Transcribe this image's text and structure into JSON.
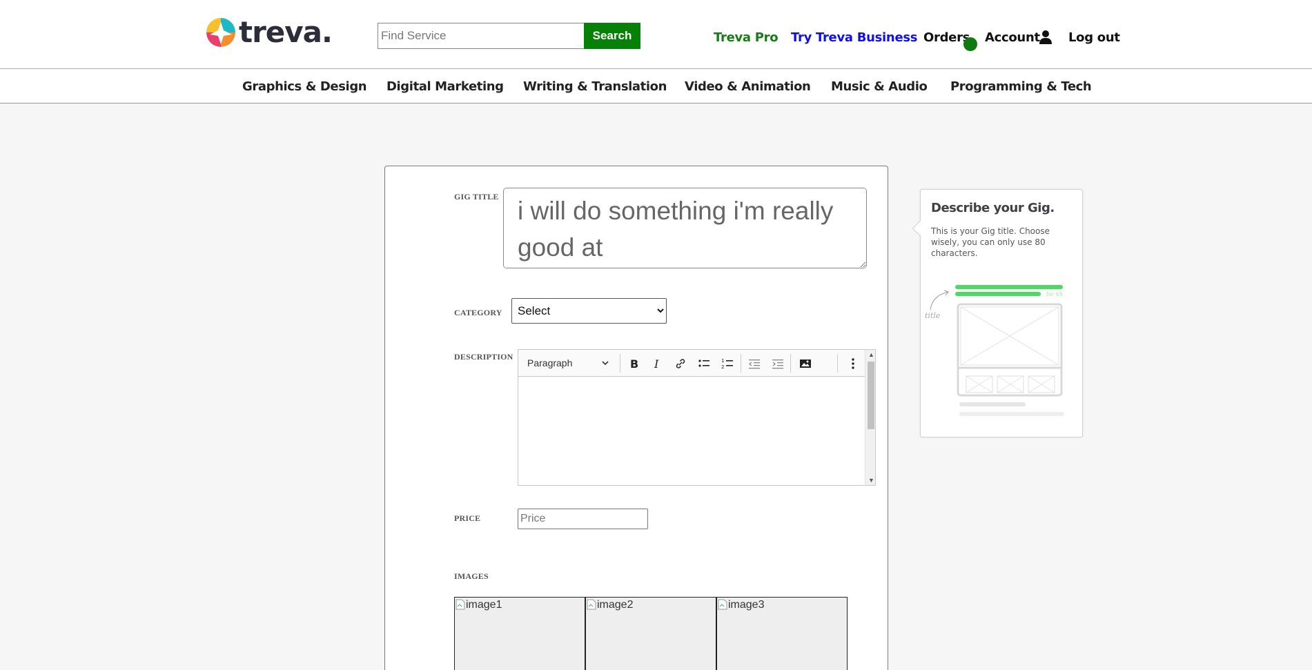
{
  "brand": {
    "name": "treva."
  },
  "search": {
    "placeholder": "Find Service",
    "button_label": "Search"
  },
  "nav": {
    "pro": "Treva Pro",
    "business": "Try Treva Business",
    "orders": "Orders",
    "account": "Account",
    "logout": "Log out"
  },
  "categories": [
    "Graphics & Design",
    "Digital Marketing",
    "Writing & Translation",
    "Video & Animation",
    "Music & Audio",
    "Programming & Tech"
  ],
  "form": {
    "gig_title_label": "GIG TITLE",
    "gig_title_value": "i will do something i'm really good at",
    "category_label": "CATEGORY",
    "category_selected": "Select",
    "description_label": "DESCRIPTION",
    "editor_block_style": "Paragraph",
    "price_label": "PRICE",
    "price_placeholder": "Price",
    "images_label": "IMAGES",
    "images": [
      "image1",
      "image2",
      "image3"
    ]
  },
  "tip": {
    "title": "Describe your Gig.",
    "text": "This is your Gig title. Choose wisely, you can only use 80 characters.",
    "art_price_caption": "for $5",
    "art_title_caption": "title"
  },
  "colors": {
    "green": "#078007",
    "blue_link": "#1010e6",
    "background": "#f6f6f6"
  }
}
